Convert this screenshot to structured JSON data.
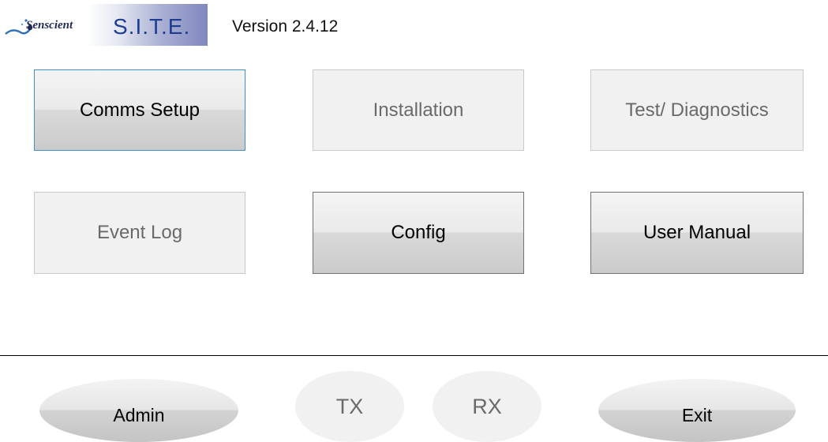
{
  "header": {
    "logo_brand": "Senscient",
    "logo_product": "S.I.T.E.",
    "version": "Version 2.4.12"
  },
  "menu": {
    "comms_setup": "Comms Setup",
    "installation": "Installation",
    "test_diagnostics": "Test/ Diagnostics",
    "event_log": "Event Log",
    "config": "Config",
    "user_manual": "User Manual"
  },
  "footer": {
    "admin": "Admin",
    "tx": "TX",
    "rx": "RX",
    "exit": "Exit"
  },
  "colors": {
    "brand_navy": "#1f2a55",
    "product_blue": "#1e3c92",
    "focus_border": "#3d8fcf",
    "disabled_text": "#6a6a6a"
  }
}
